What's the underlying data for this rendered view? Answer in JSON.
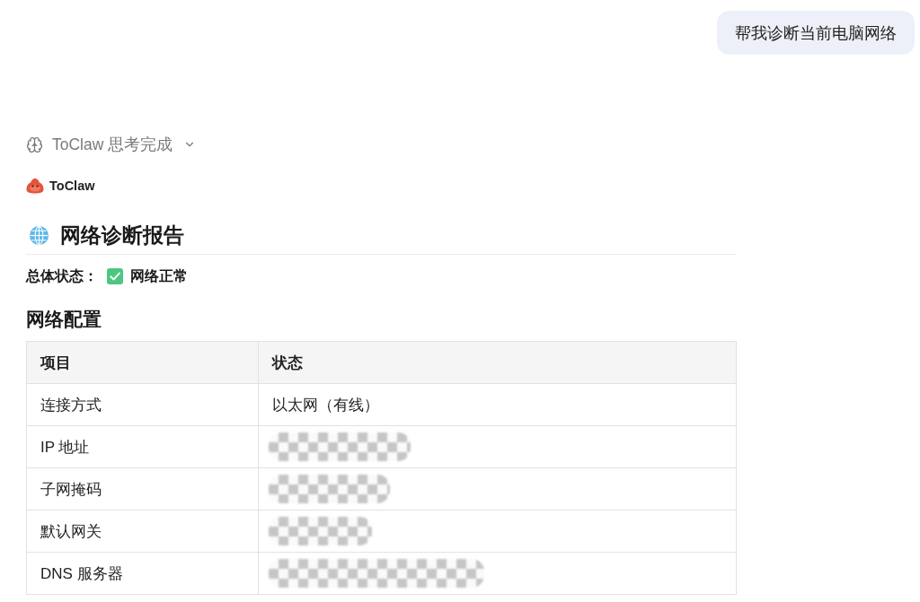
{
  "user_message": {
    "text": "帮我诊断当前电脑网络"
  },
  "thinking": {
    "label": "ToClaw 思考完成",
    "expanded": false
  },
  "assistant": {
    "name": "ToClaw"
  },
  "report": {
    "title": "网络诊断报告",
    "status_label": "总体状态：",
    "status_text": "网络正常",
    "section_title": "网络配置",
    "table": {
      "columns": [
        "项目",
        "状态"
      ],
      "rows": [
        {
          "item": "连接方式",
          "value": {
            "kind": "text",
            "text": "以太网（有线）"
          }
        },
        {
          "item": "IP 地址",
          "value": {
            "kind": "redacted"
          }
        },
        {
          "item": "子网掩码",
          "value": {
            "kind": "redacted"
          }
        },
        {
          "item": "默认网关",
          "value": {
            "kind": "redacted"
          }
        },
        {
          "item": "DNS 服务器",
          "value": {
            "kind": "redacted"
          }
        }
      ]
    }
  }
}
